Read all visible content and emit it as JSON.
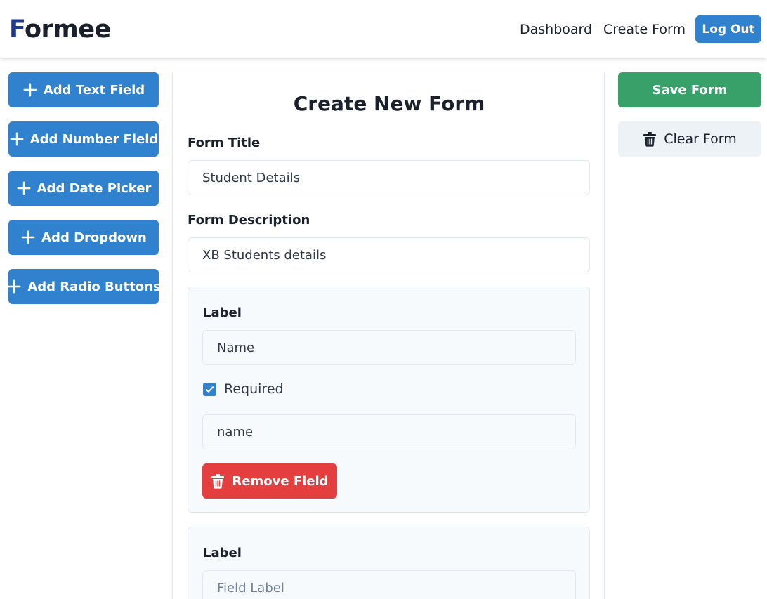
{
  "header": {
    "logo_first": "F",
    "logo_rest": "ormee",
    "nav": {
      "dashboard": "Dashboard",
      "create_form": "Create Form"
    },
    "logout_label": "Log Out"
  },
  "sidebar": {
    "buttons": [
      {
        "label": "Add Text Field",
        "icon": "plus-icon"
      },
      {
        "label": "Add Number Field",
        "icon": "plus-icon"
      },
      {
        "label": "Add Date Picker",
        "icon": "plus-icon"
      },
      {
        "label": "Add Dropdown",
        "icon": "plus-icon"
      },
      {
        "label": "Add Radio Buttons",
        "icon": "plus-icon"
      }
    ]
  },
  "form": {
    "page_title": "Create New Form",
    "title_label": "Form Title",
    "title_value": "Student Details",
    "description_label": "Form Description",
    "description_value": "XB Students details",
    "fields": [
      {
        "label_caption": "Label",
        "label_value": "Name",
        "required_caption": "Required",
        "required": true,
        "name_value": "name",
        "remove_label": "Remove Field"
      },
      {
        "label_caption": "Label",
        "label_placeholder": "Field Label"
      }
    ]
  },
  "actions": {
    "save_label": "Save Form",
    "clear_label": "Clear Form"
  },
  "colors": {
    "primary": "#3182ce",
    "success": "#38a169",
    "danger": "#e53e3e",
    "neutral": "#edf2f7"
  }
}
